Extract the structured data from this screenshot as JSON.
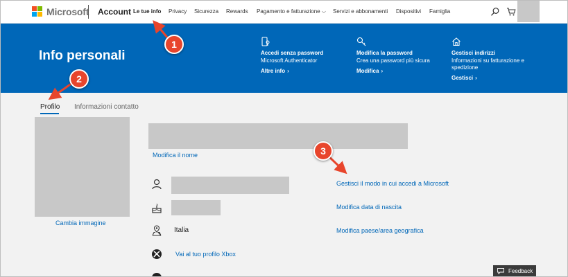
{
  "header": {
    "brand": "Microsoft",
    "section": "Account",
    "nav": [
      {
        "label": "Le tue info",
        "active": true
      },
      {
        "label": "Privacy"
      },
      {
        "label": "Sicurezza"
      },
      {
        "label": "Rewards"
      },
      {
        "label": "Pagamento e fatturazione ⌵"
      },
      {
        "label": "Servizi e abbonamenti"
      },
      {
        "label": "Dispositivi"
      },
      {
        "label": "Famiglia"
      }
    ],
    "icons": {
      "search": "search-icon",
      "cart": "cart-icon"
    }
  },
  "banner": {
    "title": "Info personali",
    "cards": [
      {
        "icon": "phone-key-icon",
        "title": "Accedi senza password",
        "desc": "Microsoft Authenticator",
        "link": "Altre info"
      },
      {
        "icon": "key-icon",
        "title": "Modifica la password",
        "desc": "Crea una password più sicura",
        "link": "Modifica"
      },
      {
        "icon": "home-icon",
        "title": "Gestisci indirizzi",
        "desc": "Informazioni su fatturazione e spedizione",
        "link": "Gestisci"
      }
    ]
  },
  "tabs": {
    "profile": "Profilo",
    "contact": "Informazioni contatto"
  },
  "profile": {
    "change_photo": "Cambia immagine",
    "edit_name": "Modifica il nome",
    "rows": [
      {
        "icon": "person-icon",
        "value": "",
        "link": "Gestisci il modo in cui accedi a Microsoft"
      },
      {
        "icon": "birthday-cake-icon",
        "value": "",
        "link": "Modifica data di nascita"
      },
      {
        "icon": "location-pin-icon",
        "value": "Italia",
        "link": "Modifica paese/area geografica"
      },
      {
        "icon": "xbox-icon",
        "value": "Vai al tuo profilo Xbox",
        "link": ""
      }
    ]
  },
  "feedback": "Feedback",
  "annotations": [
    "1",
    "2",
    "3"
  ],
  "colors": {
    "brand_blue": "#0067b8",
    "marker_red": "#e8452c",
    "redacted_gray": "#c8c8c8"
  }
}
